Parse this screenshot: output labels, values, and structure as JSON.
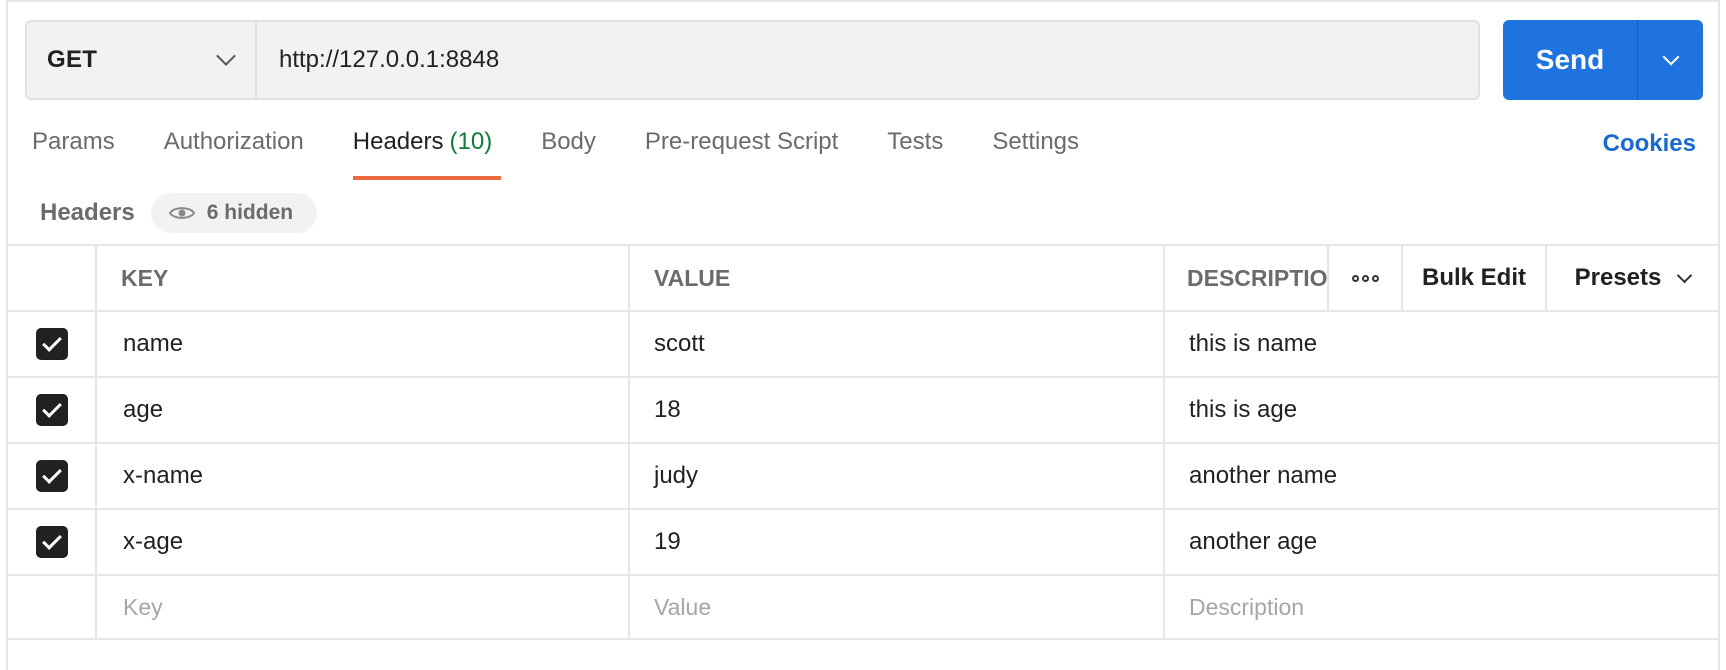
{
  "request": {
    "method": "GET",
    "url": "http://127.0.0.1:8848",
    "send_label": "Send"
  },
  "tabs": [
    {
      "label": "Params",
      "count": ""
    },
    {
      "label": "Authorization",
      "count": ""
    },
    {
      "label": "Headers",
      "count": "(10)"
    },
    {
      "label": "Body",
      "count": ""
    },
    {
      "label": "Pre-request Script",
      "count": ""
    },
    {
      "label": "Tests",
      "count": ""
    },
    {
      "label": "Settings",
      "count": ""
    }
  ],
  "active_tab": "Headers",
  "cookies_label": "Cookies",
  "headers_section": {
    "title": "Headers",
    "hidden_label": "6 hidden"
  },
  "table": {
    "columns": {
      "key": "KEY",
      "value": "VALUE",
      "description": "DESCRIPTIO"
    },
    "bulk_edit_label": "Bulk Edit",
    "presets_label": "Presets",
    "rows": [
      {
        "checked": true,
        "key": "name",
        "value": "scott",
        "description": "this is name"
      },
      {
        "checked": true,
        "key": "age",
        "value": "18",
        "description": "this is age"
      },
      {
        "checked": true,
        "key": "x-name",
        "value": "judy",
        "description": "another name"
      },
      {
        "checked": true,
        "key": "x-age",
        "value": "19",
        "description": "another age"
      }
    ],
    "placeholders": {
      "key": "Key",
      "value": "Value",
      "description": "Description"
    }
  },
  "colors": {
    "accent": "#1f73e0",
    "active_tab_underline": "#ed6a3f",
    "count": "#0f7b3a",
    "link": "#1a6ad1"
  }
}
